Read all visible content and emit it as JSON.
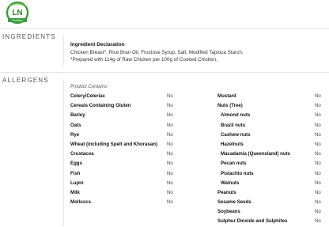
{
  "logo": {
    "text": "LN",
    "subtext": "Certified"
  },
  "ingredients": {
    "section_label": "INGREDIENTS",
    "title": "Ingredient Declaration",
    "text": "Chicken Breast*, Rice Bran Oil, Fructose Syrup, Salt, Modified Tapioca Starch.",
    "note": "*Prepared with 114g of Raw Chicken per 100g of Cooked Chicken."
  },
  "allergens": {
    "section_label": "ALLERGENS",
    "contains_label": "Product Contains:",
    "left": [
      {
        "name": "Celery/Celeriac",
        "value": "No"
      },
      {
        "name": "Cereals Containing Gluten",
        "value": "No"
      },
      {
        "name": "Barley",
        "value": "No"
      },
      {
        "name": "Oats",
        "value": "No"
      },
      {
        "name": "Rye",
        "value": "No"
      },
      {
        "name": "Wheat (including Spelt and Khorasan)",
        "value": "No"
      },
      {
        "name": "Crustacea",
        "value": "No"
      },
      {
        "name": "Eggs",
        "value": "No"
      },
      {
        "name": "Fish",
        "value": "No"
      },
      {
        "name": "Lupin",
        "value": "No"
      },
      {
        "name": "Milk",
        "value": "No"
      },
      {
        "name": "Molluscs",
        "value": "No"
      }
    ],
    "right": [
      {
        "name": "Mustard",
        "value": "No"
      },
      {
        "name": "Nuts (Tree)",
        "value": "No"
      },
      {
        "name": "Almond nuts",
        "value": "No",
        "sub": true
      },
      {
        "name": "Brazil nuts",
        "value": "No",
        "sub": true
      },
      {
        "name": "Cashew nuts",
        "value": "No",
        "sub": true
      },
      {
        "name": "Hazelnuts",
        "value": "No",
        "sub": true
      },
      {
        "name": "Macadamia (Queensland) nuts",
        "value": "No",
        "sub": true
      },
      {
        "name": "Pecan nuts",
        "value": "No",
        "sub": true
      },
      {
        "name": "Pistachio nuts",
        "value": "No",
        "sub": true
      },
      {
        "name": "Walnuts",
        "value": "No",
        "sub": true
      },
      {
        "name": "Peanuts",
        "value": "No"
      },
      {
        "name": "Sesame Seeds",
        "value": "No"
      },
      {
        "name": "Soybeans",
        "value": "No"
      },
      {
        "name": "Sulphur Dioxide and Sulphites",
        "value": "No"
      }
    ]
  }
}
